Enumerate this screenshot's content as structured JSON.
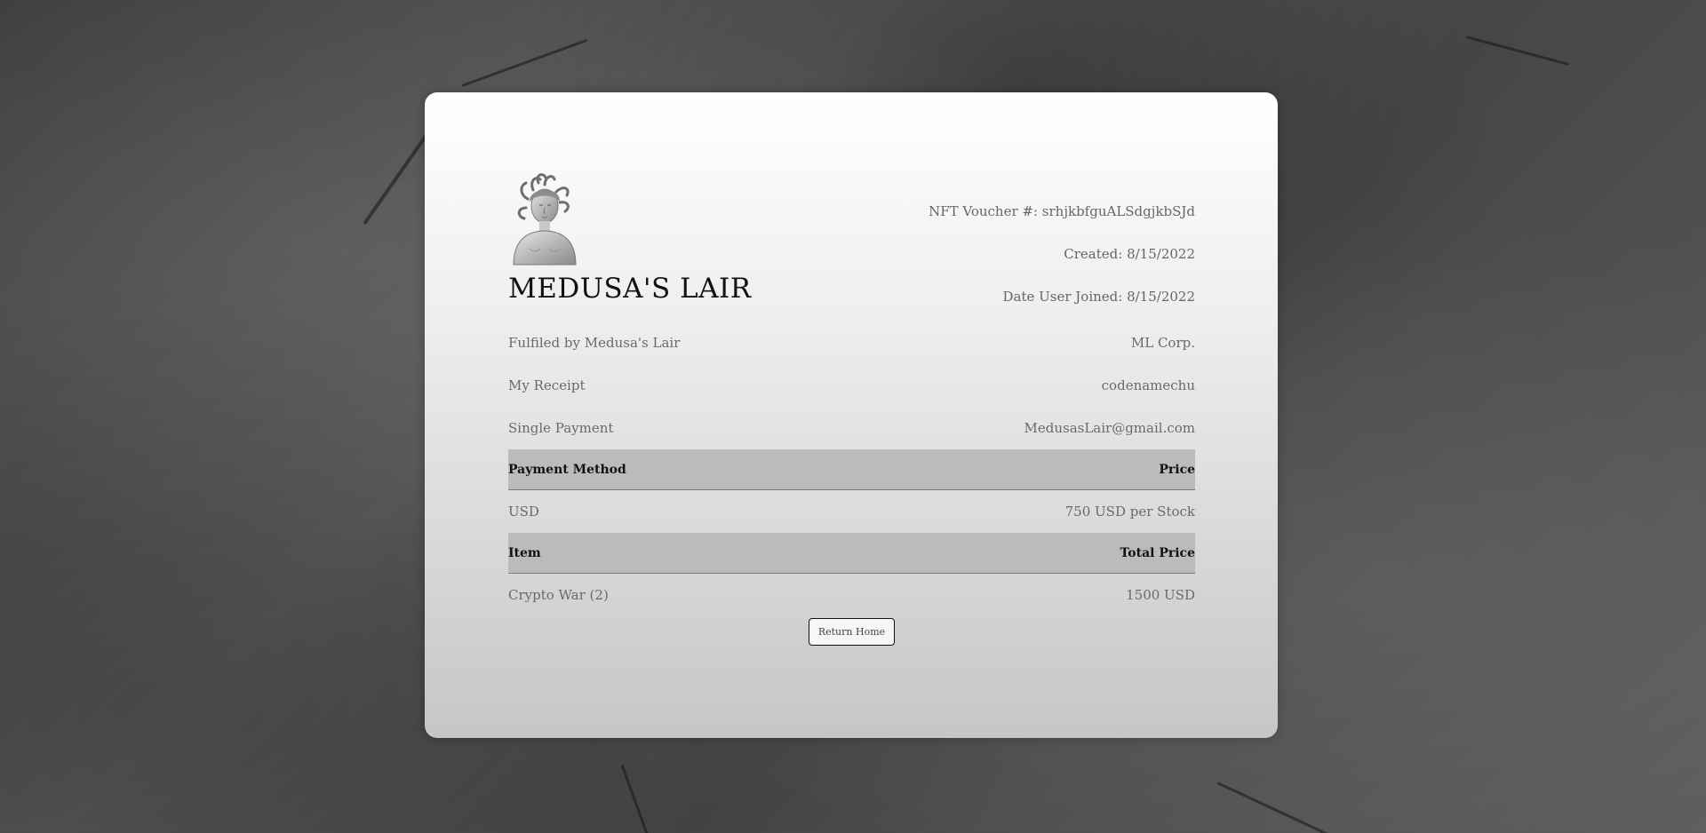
{
  "brand": {
    "name": "MEDUSA'S LAIR"
  },
  "voucher": {
    "number": "NFT Voucher #: srhjkbfguALSdgjkbSJd",
    "created": "Created: 8/15/2022",
    "joined": "Date User Joined: 8/15/2022"
  },
  "details": [
    {
      "left": "Fulfiled by Medusa's Lair",
      "right": "ML Corp."
    },
    {
      "left": "My Receipt",
      "right": "codenamechu"
    },
    {
      "left": "Single Payment",
      "right": "MedusasLair@gmail.com"
    }
  ],
  "payment_table": {
    "headers": {
      "left": "Payment Method",
      "right": "Price"
    },
    "row": {
      "left": "USD",
      "right": "750 USD per Stock"
    }
  },
  "item_table": {
    "headers": {
      "left": "Item",
      "right": "Total Price"
    },
    "row": {
      "left": "Crypto War (2)",
      "right": "1500 USD"
    }
  },
  "actions": {
    "return_home": "Return Home"
  }
}
